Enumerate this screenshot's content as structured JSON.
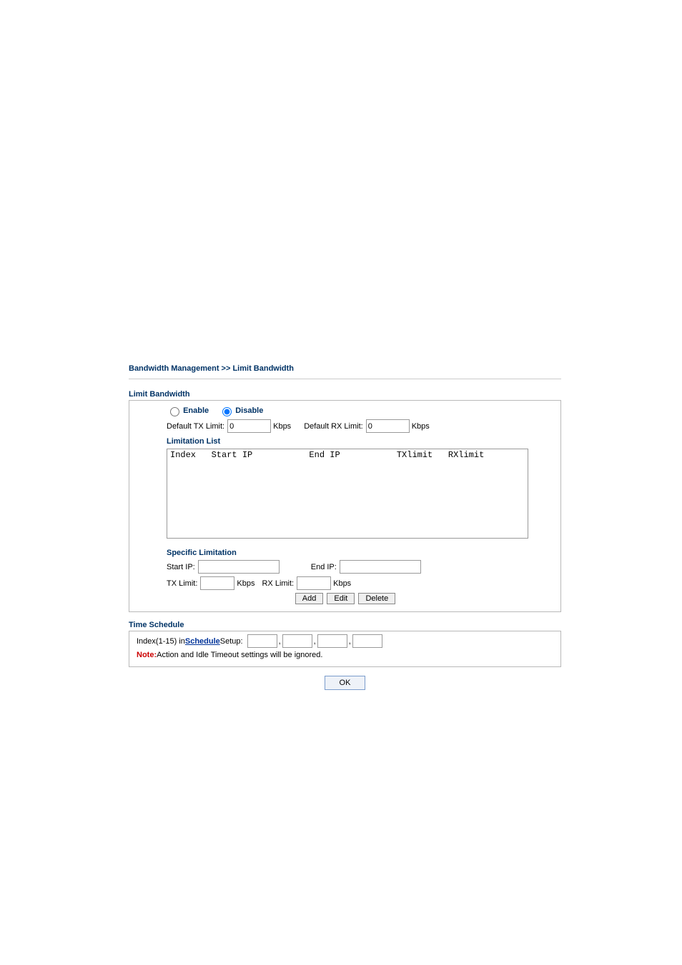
{
  "breadcrumb": "Bandwidth Management >> Limit Bandwidth",
  "limitBandwidth": {
    "title": "Limit Bandwidth",
    "enableLabel": "Enable",
    "disableLabel": "Disable",
    "defaultTxLabel": "Default TX Limit:",
    "defaultTxValue": "0",
    "defaultRxLabel": "Default RX Limit:",
    "defaultRxValue": "0",
    "kbps": "Kbps",
    "limitationListTitle": "Limitation List",
    "listHeader": "Index   Start IP           End IP           TXlimit   RXlimit",
    "specificTitle": "Specific Limitation",
    "startIpLabel": "Start IP:",
    "endIpLabel": "End IP:",
    "txLimitLabel": "TX Limit:",
    "rxLimitLabel": "RX Limit:",
    "addBtn": "Add",
    "editBtn": "Edit",
    "deleteBtn": "Delete"
  },
  "timeSchedule": {
    "title": "Time Schedule",
    "indexLabelPre": "Index(1-15) in ",
    "scheduleLink": "Schedule",
    "indexLabelPost": " Setup:",
    "noteLabel": "Note:",
    "noteText": " Action and Idle Timeout settings will be ignored."
  },
  "okBtn": "OK"
}
